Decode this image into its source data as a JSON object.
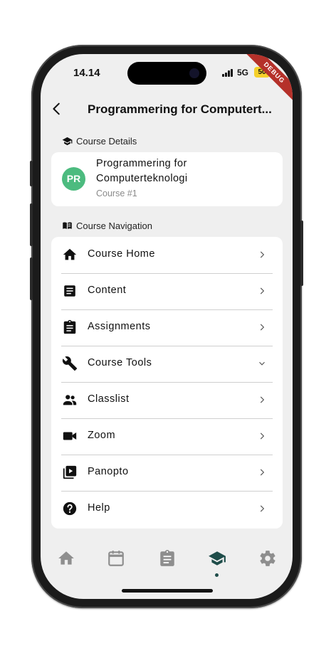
{
  "status_bar": {
    "time": "14.14",
    "network": "5G",
    "battery": "50",
    "debug_banner": "DEBUG"
  },
  "header": {
    "title": "Programmering for Computert..."
  },
  "course_details": {
    "section_label": "Course Details",
    "avatar_initials": "PR",
    "avatar_color": "#4cbb7f",
    "course_name": "Programmering for Computerteknologi",
    "course_number": "Course #1"
  },
  "course_navigation": {
    "section_label": "Course Navigation",
    "items": [
      {
        "label": "Course Home",
        "icon": "home-icon",
        "chevron": "right"
      },
      {
        "label": "Content",
        "icon": "document-icon",
        "chevron": "right"
      },
      {
        "label": "Assignments",
        "icon": "clipboard-icon",
        "chevron": "right"
      },
      {
        "label": "Course Tools",
        "icon": "wrench-icon",
        "chevron": "down"
      },
      {
        "label": "Classlist",
        "icon": "people-icon",
        "chevron": "right"
      },
      {
        "label": "Zoom",
        "icon": "video-camera-icon",
        "chevron": "right"
      },
      {
        "label": "Panopto",
        "icon": "video-library-icon",
        "chevron": "right"
      },
      {
        "label": "Help",
        "icon": "help-circle-icon",
        "chevron": "right"
      }
    ]
  },
  "bottom_nav": {
    "tabs": [
      "home-icon",
      "calendar-icon",
      "assignment-icon",
      "school-icon",
      "settings-icon"
    ],
    "active_tab": "school-icon",
    "active_color": "#1f4d4a",
    "inactive_color": "#8e8e8e"
  }
}
